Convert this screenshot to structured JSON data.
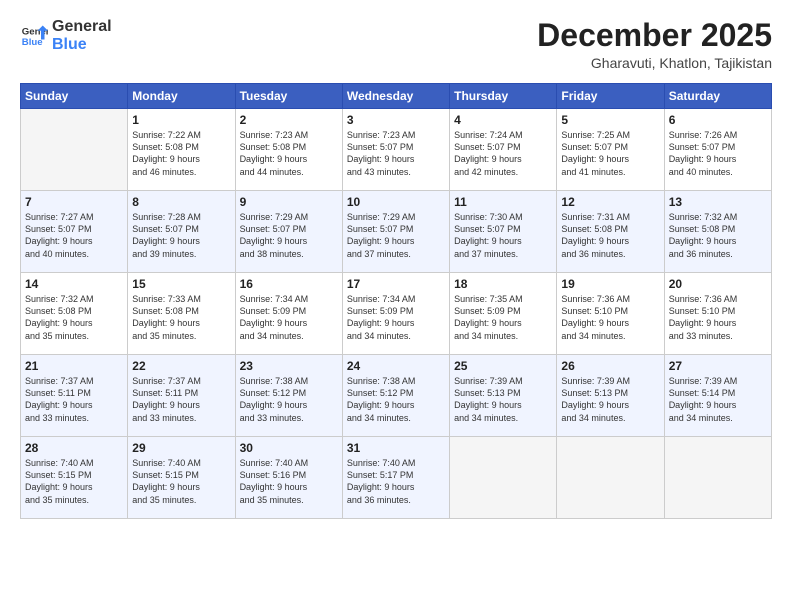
{
  "logo": {
    "line1": "General",
    "line2": "Blue"
  },
  "title": "December 2025",
  "location": "Gharavuti, Khatlon, Tajikistan",
  "weekdays": [
    "Sunday",
    "Monday",
    "Tuesday",
    "Wednesday",
    "Thursday",
    "Friday",
    "Saturday"
  ],
  "weeks": [
    [
      {
        "day": "",
        "info": ""
      },
      {
        "day": "1",
        "info": "Sunrise: 7:22 AM\nSunset: 5:08 PM\nDaylight: 9 hours\nand 46 minutes."
      },
      {
        "day": "2",
        "info": "Sunrise: 7:23 AM\nSunset: 5:08 PM\nDaylight: 9 hours\nand 44 minutes."
      },
      {
        "day": "3",
        "info": "Sunrise: 7:23 AM\nSunset: 5:07 PM\nDaylight: 9 hours\nand 43 minutes."
      },
      {
        "day": "4",
        "info": "Sunrise: 7:24 AM\nSunset: 5:07 PM\nDaylight: 9 hours\nand 42 minutes."
      },
      {
        "day": "5",
        "info": "Sunrise: 7:25 AM\nSunset: 5:07 PM\nDaylight: 9 hours\nand 41 minutes."
      },
      {
        "day": "6",
        "info": "Sunrise: 7:26 AM\nSunset: 5:07 PM\nDaylight: 9 hours\nand 40 minutes."
      }
    ],
    [
      {
        "day": "7",
        "info": "Sunrise: 7:27 AM\nSunset: 5:07 PM\nDaylight: 9 hours\nand 40 minutes."
      },
      {
        "day": "8",
        "info": "Sunrise: 7:28 AM\nSunset: 5:07 PM\nDaylight: 9 hours\nand 39 minutes."
      },
      {
        "day": "9",
        "info": "Sunrise: 7:29 AM\nSunset: 5:07 PM\nDaylight: 9 hours\nand 38 minutes."
      },
      {
        "day": "10",
        "info": "Sunrise: 7:29 AM\nSunset: 5:07 PM\nDaylight: 9 hours\nand 37 minutes."
      },
      {
        "day": "11",
        "info": "Sunrise: 7:30 AM\nSunset: 5:07 PM\nDaylight: 9 hours\nand 37 minutes."
      },
      {
        "day": "12",
        "info": "Sunrise: 7:31 AM\nSunset: 5:08 PM\nDaylight: 9 hours\nand 36 minutes."
      },
      {
        "day": "13",
        "info": "Sunrise: 7:32 AM\nSunset: 5:08 PM\nDaylight: 9 hours\nand 36 minutes."
      }
    ],
    [
      {
        "day": "14",
        "info": "Sunrise: 7:32 AM\nSunset: 5:08 PM\nDaylight: 9 hours\nand 35 minutes."
      },
      {
        "day": "15",
        "info": "Sunrise: 7:33 AM\nSunset: 5:08 PM\nDaylight: 9 hours\nand 35 minutes."
      },
      {
        "day": "16",
        "info": "Sunrise: 7:34 AM\nSunset: 5:09 PM\nDaylight: 9 hours\nand 34 minutes."
      },
      {
        "day": "17",
        "info": "Sunrise: 7:34 AM\nSunset: 5:09 PM\nDaylight: 9 hours\nand 34 minutes."
      },
      {
        "day": "18",
        "info": "Sunrise: 7:35 AM\nSunset: 5:09 PM\nDaylight: 9 hours\nand 34 minutes."
      },
      {
        "day": "19",
        "info": "Sunrise: 7:36 AM\nSunset: 5:10 PM\nDaylight: 9 hours\nand 34 minutes."
      },
      {
        "day": "20",
        "info": "Sunrise: 7:36 AM\nSunset: 5:10 PM\nDaylight: 9 hours\nand 33 minutes."
      }
    ],
    [
      {
        "day": "21",
        "info": "Sunrise: 7:37 AM\nSunset: 5:11 PM\nDaylight: 9 hours\nand 33 minutes."
      },
      {
        "day": "22",
        "info": "Sunrise: 7:37 AM\nSunset: 5:11 PM\nDaylight: 9 hours\nand 33 minutes."
      },
      {
        "day": "23",
        "info": "Sunrise: 7:38 AM\nSunset: 5:12 PM\nDaylight: 9 hours\nand 33 minutes."
      },
      {
        "day": "24",
        "info": "Sunrise: 7:38 AM\nSunset: 5:12 PM\nDaylight: 9 hours\nand 34 minutes."
      },
      {
        "day": "25",
        "info": "Sunrise: 7:39 AM\nSunset: 5:13 PM\nDaylight: 9 hours\nand 34 minutes."
      },
      {
        "day": "26",
        "info": "Sunrise: 7:39 AM\nSunset: 5:13 PM\nDaylight: 9 hours\nand 34 minutes."
      },
      {
        "day": "27",
        "info": "Sunrise: 7:39 AM\nSunset: 5:14 PM\nDaylight: 9 hours\nand 34 minutes."
      }
    ],
    [
      {
        "day": "28",
        "info": "Sunrise: 7:40 AM\nSunset: 5:15 PM\nDaylight: 9 hours\nand 35 minutes."
      },
      {
        "day": "29",
        "info": "Sunrise: 7:40 AM\nSunset: 5:15 PM\nDaylight: 9 hours\nand 35 minutes."
      },
      {
        "day": "30",
        "info": "Sunrise: 7:40 AM\nSunset: 5:16 PM\nDaylight: 9 hours\nand 35 minutes."
      },
      {
        "day": "31",
        "info": "Sunrise: 7:40 AM\nSunset: 5:17 PM\nDaylight: 9 hours\nand 36 minutes."
      },
      {
        "day": "",
        "info": ""
      },
      {
        "day": "",
        "info": ""
      },
      {
        "day": "",
        "info": ""
      }
    ]
  ]
}
